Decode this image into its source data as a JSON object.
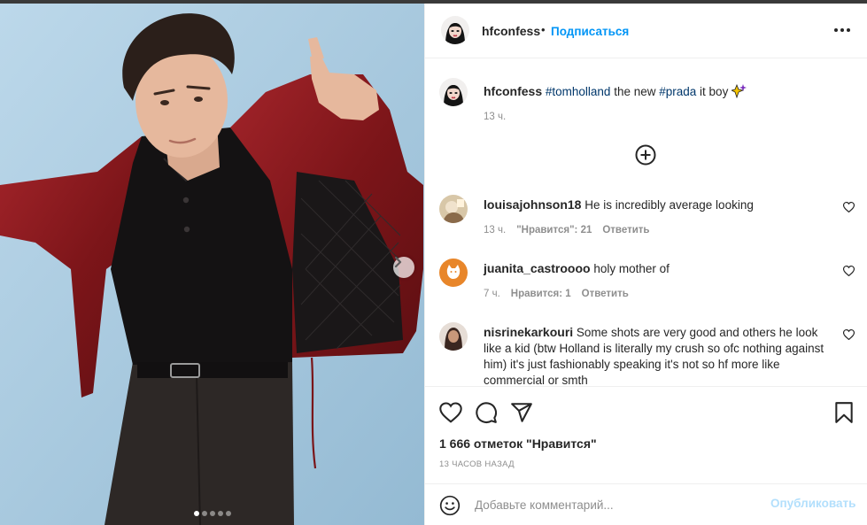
{
  "post": {
    "author": "hfconfess",
    "follow_label": "Подписаться",
    "separator": "•",
    "caption": {
      "author": "hfconfess",
      "segments": [
        {
          "text": "#tomholland",
          "kind": "tag"
        },
        {
          "text": " the new ",
          "kind": "text"
        },
        {
          "text": "#prada",
          "kind": "tag"
        },
        {
          "text": " it boy ",
          "kind": "text"
        }
      ],
      "emoji_icon": "sparkle-emoji-icon",
      "time": "13 ч."
    },
    "carousel": {
      "count": 5,
      "active": 1
    }
  },
  "comments": [
    {
      "user": "louisajohnson18",
      "text": "He is incredibly average looking",
      "time": "13 ч.",
      "likes": "\"Нравится\": 21",
      "reply": "Ответить",
      "avatar_color": "#d8c7a8"
    },
    {
      "user": "juanita_castroooo",
      "text": "holy mother of",
      "time": "7 ч.",
      "likes": "Нравится: 1",
      "reply": "Ответить",
      "avatar_color": "#e8862a"
    },
    {
      "user": "nisrinekarkouri",
      "text": "Some shots are very good and others he look like a kid (btw Holland is literally my crush so ofc nothing against him) it's just fashionably speaking it's not so hf more like commercial or smth",
      "avatar_color": "#6b4a3a"
    }
  ],
  "footer": {
    "likes": "1 666 отметок \"Нравится\"",
    "time_ago": "13 ЧАСОВ НАЗАД",
    "placeholder": "Добавьте комментарий...",
    "publish": "Опубликовать"
  },
  "colors": {
    "accent": "#0095f6",
    "publish_disabled": "#b2dffc",
    "tag": "#00376b",
    "meta": "#8e8e8e",
    "jacket": "#8e1a1e"
  },
  "icons": [
    "heart-icon",
    "comment-icon",
    "share-icon",
    "bookmark-icon",
    "emoji-icon",
    "more-icon",
    "load-more-icon",
    "next-arrow-icon"
  ]
}
